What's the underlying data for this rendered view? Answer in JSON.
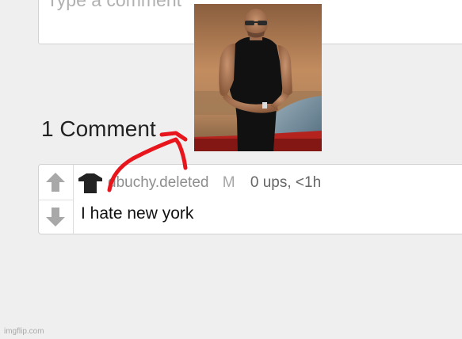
{
  "comment_input": {
    "placeholder": "Type a comment"
  },
  "photo": {
    "icon": "man-in-sunglasses-photo"
  },
  "comments_section": {
    "count_label": "1 Comment"
  },
  "comment": {
    "username": "dbuchy.deleted",
    "badge": "M",
    "stats": "0 ups, <1h",
    "text": "I hate new york",
    "avatar_icon": "t-shirt-icon",
    "upvote_icon": "up-arrow-icon",
    "downvote_icon": "down-arrow-icon"
  },
  "annotation": {
    "color": "#e8151d",
    "icon": "hand-drawn-arrow"
  },
  "watermark": "imgflip.com",
  "colors": {
    "background": "#efefef",
    "card": "#ffffff",
    "border": "#d2d2d2",
    "vote_arrow": "#a8a8a8",
    "annotation_red": "#e8151d"
  }
}
